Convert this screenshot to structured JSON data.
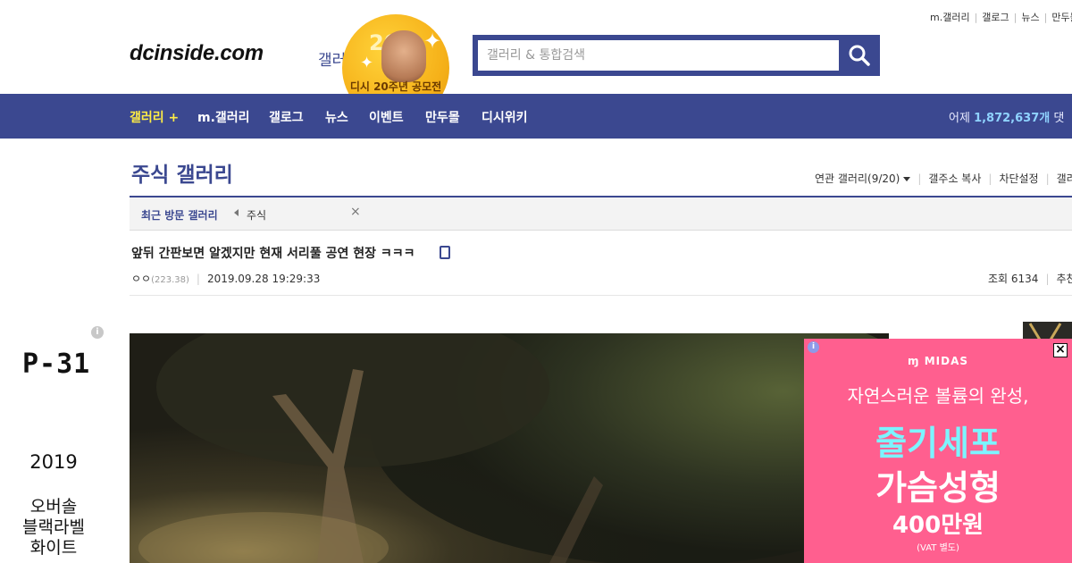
{
  "top_links": [
    "m.갤러리",
    "갤로그",
    "뉴스",
    "만두몰"
  ],
  "logo": {
    "main": "dcinside.com",
    "sub": "갤러리"
  },
  "badge": {
    "number": "20",
    "caption": "디시 20주년 공모전"
  },
  "search": {
    "placeholder": "갤러리 & 통합검색"
  },
  "nav": {
    "items": [
      "갤러리 +",
      "m.갤러리",
      "갤로그",
      "뉴스",
      "이벤트",
      "만두몰",
      "디시위키"
    ],
    "stat_prefix": "어제",
    "stat_count": "1,872,637개",
    "stat_suffix": "댓"
  },
  "gallery": {
    "title": "주식 갤러리",
    "tools": [
      "연관 갤러리(9/20)",
      "갤주소 복사",
      "차단설정",
      "갤러"
    ],
    "recent_label": "최근 방문 갤러리",
    "recent_item": "주식"
  },
  "post": {
    "title": "앞뒤 간판보면 알겠지만 현재 서리풀 공연 현장 ㅋㅋㅋ",
    "author": "ㅇㅇ",
    "ip": "(223.38)",
    "date": "2019.09.28 19:29:33",
    "views": "조회 6134",
    "recommend": "추천"
  },
  "left_ad": {
    "title": "P-31",
    "year": "2019",
    "desc_lines": [
      "오버솔",
      "블랙라벨",
      "화이트"
    ]
  },
  "popup_ad": {
    "brand": "MIDAS",
    "tagline": "자연스러운 볼륨의 완성,",
    "headline1": "줄기세포",
    "headline2": "가슴성형",
    "price": "400만원",
    "note": "(VAT 별도)"
  },
  "colors": {
    "brand": "#3b4890",
    "nav_highlight": "#ffed45",
    "ad_pink": "#ff5f8f",
    "ad_cyan": "#7cf4ff"
  }
}
